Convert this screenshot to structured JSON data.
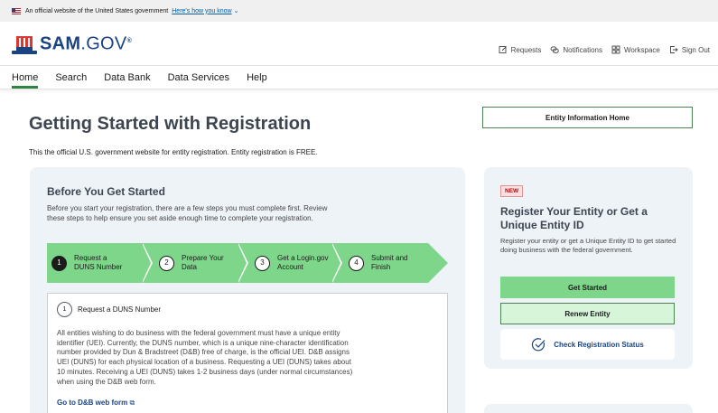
{
  "gov_banner": {
    "text": "An official website of the United States government",
    "link": "Here's how you know"
  },
  "logo": {
    "sam": "SAM",
    "gov": ".GOV",
    "reg": "®"
  },
  "header_links": [
    "Requests",
    "Notifications",
    "Workspace",
    "Sign Out"
  ],
  "nav": [
    "Home",
    "Search",
    "Data Bank",
    "Data Services",
    "Help"
  ],
  "page": {
    "title": "Getting Started with Registration",
    "entity_home_button": "Entity Information Home",
    "intro": "This the official U.S. government website for entity registration. Entity registration is FREE."
  },
  "before": {
    "title": "Before You Get Started",
    "desc": "Before you start your registration, there are a few steps you must complete first. Review these steps to help ensure you set aside enough time to complete your registration.",
    "steps": [
      {
        "num": "1",
        "line1": "Request a",
        "line2": "DUNS Number"
      },
      {
        "num": "2",
        "line1": "Prepare Your",
        "line2": "Data"
      },
      {
        "num": "3",
        "line1": "Get a Login.gov",
        "line2": "Account"
      },
      {
        "num": "4",
        "line1": "Submit and",
        "line2": "Finish"
      }
    ],
    "detail": {
      "num": "1",
      "heading": "Request a DUNS Number",
      "body": "All entities wishing to do business with the federal government must have a unique entity identifier (UEI). Currently, the DUNS number, which is a unique nine-character identification number provided by Dun & Bradstreet (D&B) free of charge, is the official UEI. D&B assigns UEI (DUNS) for each physical location of a business. Requesting a UEI (DUNS) takes about 10 minutes. Receiving a UEI (DUNS) takes 1-2 business days (under normal circumstances) when using the D&B web form.",
      "link": "Go to D&B web form"
    }
  },
  "register": {
    "badge": "NEW",
    "title": "Register Your Entity or Get a Unique Entity ID",
    "desc": "Register your entity or get a Unique Entity ID to get started doing business with the federal government.",
    "get_started": "Get Started",
    "renew": "Renew Entity",
    "check_status": "Check Registration Status"
  },
  "colors": {
    "accent_green": "#7ed68a",
    "brand_blue": "#1a4480",
    "panel_bg": "#eef3f8"
  }
}
